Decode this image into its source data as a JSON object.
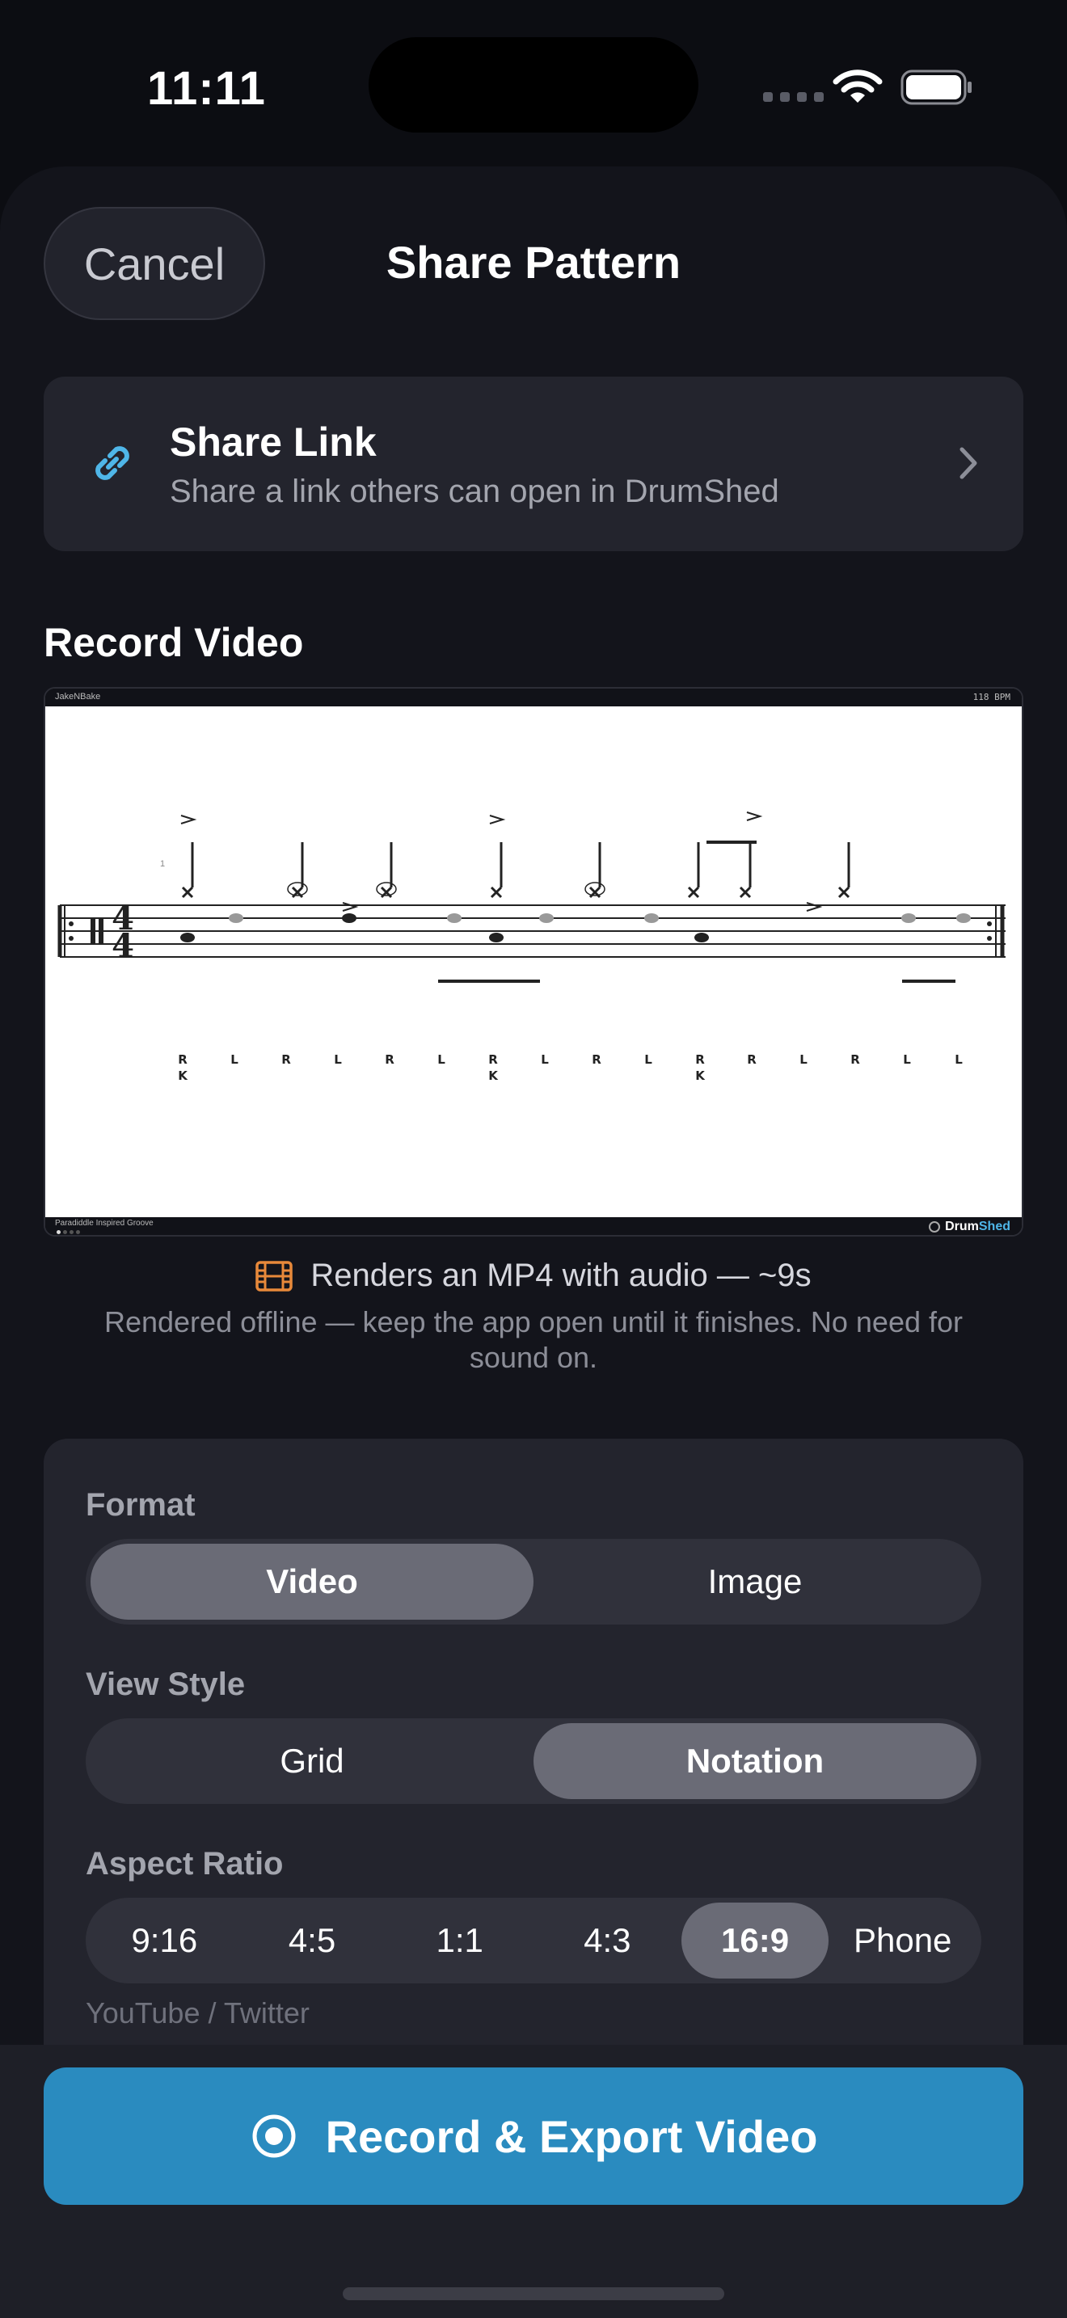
{
  "status_bar": {
    "time": "11:11",
    "icons": [
      "signal-dots-icon",
      "wifi-icon",
      "battery-icon"
    ]
  },
  "sheet": {
    "cancel_label": "Cancel",
    "title": "Share Pattern"
  },
  "share_link": {
    "title": "Share Link",
    "subtitle": "Share a link others can open in DrumShed",
    "icon": "link-icon",
    "accent": "#4fb6e8"
  },
  "record_section": {
    "title": "Record Video"
  },
  "preview": {
    "author": "JakeNBake",
    "bpm": "118 BPM",
    "pattern_name": "Paradiddle Inspired Groove",
    "brand_drum": "Drum",
    "brand_shed": "Shed",
    "measure_number": "1",
    "sticking": [
      {
        "top": "R",
        "bottom": "K"
      },
      {
        "top": "L",
        "bottom": ""
      },
      {
        "top": "R",
        "bottom": ""
      },
      {
        "top": "L",
        "bottom": ""
      },
      {
        "top": "R",
        "bottom": ""
      },
      {
        "top": "L",
        "bottom": ""
      },
      {
        "top": "R",
        "bottom": "K"
      },
      {
        "top": "L",
        "bottom": ""
      },
      {
        "top": "R",
        "bottom": ""
      },
      {
        "top": "L",
        "bottom": ""
      },
      {
        "top": "R",
        "bottom": "K"
      },
      {
        "top": "R",
        "bottom": ""
      },
      {
        "top": "L",
        "bottom": ""
      },
      {
        "top": "R",
        "bottom": ""
      },
      {
        "top": "L",
        "bottom": ""
      },
      {
        "top": "L",
        "bottom": ""
      }
    ]
  },
  "render_info": {
    "line": "Renders an MP4 with audio — ~9s",
    "note": "Rendered offline — keep the app open until it finishes. No need for sound on.",
    "icon_color": "#e8893a"
  },
  "options": {
    "format": {
      "label": "Format",
      "options": [
        "Video",
        "Image"
      ],
      "selected": "Video"
    },
    "view_style": {
      "label": "View Style",
      "options": [
        "Grid",
        "Notation"
      ],
      "selected": "Notation"
    },
    "aspect_ratio": {
      "label": "Aspect Ratio",
      "options": [
        "9:16",
        "4:5",
        "1:1",
        "4:3",
        "16:9",
        "Phone"
      ],
      "selected": "16:9",
      "hint": "YouTube / Twitter"
    }
  },
  "export": {
    "label": "Record & Export Video",
    "color": "#2a8bbf"
  }
}
